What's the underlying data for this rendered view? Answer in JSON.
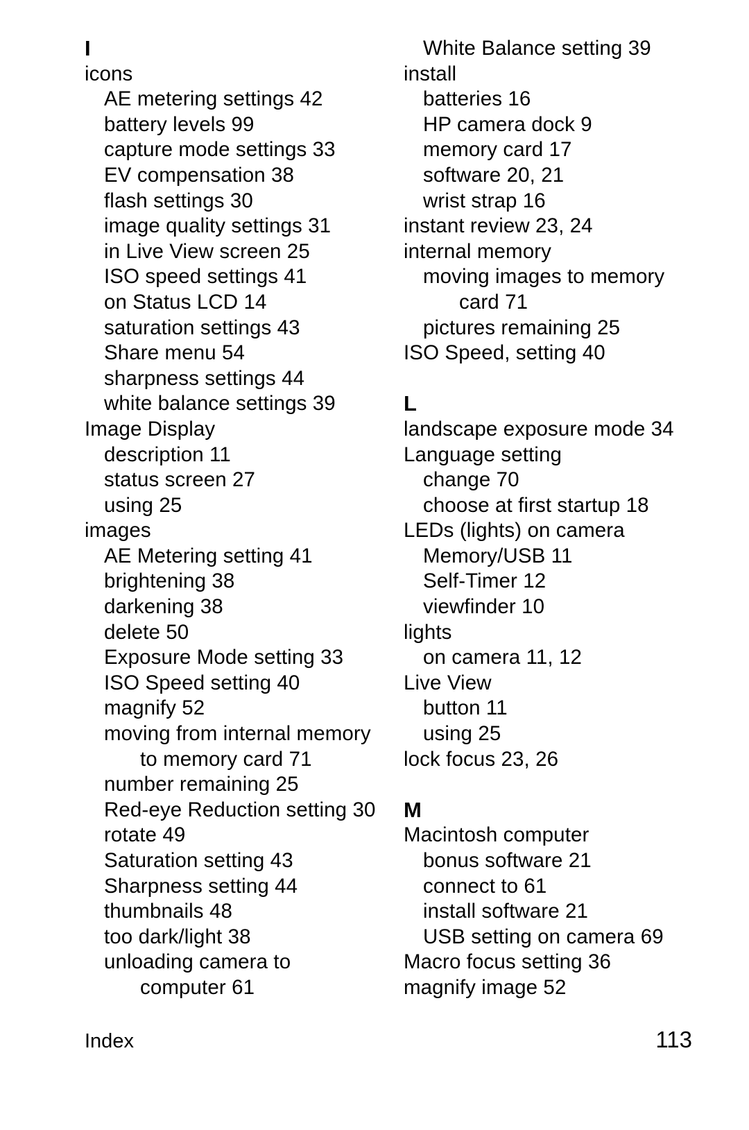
{
  "document": {
    "type": "index",
    "footer": {
      "label": "Index",
      "page_number": "113"
    }
  },
  "columns": {
    "left": {
      "blocks": [
        {
          "kind": "letter",
          "text": "I",
          "spaced_before": false
        },
        {
          "kind": "entry",
          "level": 0,
          "text": "icons"
        },
        {
          "kind": "entry",
          "level": 1,
          "text": "AE metering settings 42"
        },
        {
          "kind": "entry",
          "level": 1,
          "text": "battery levels 99"
        },
        {
          "kind": "entry",
          "level": 1,
          "text": "capture mode settings 33"
        },
        {
          "kind": "entry",
          "level": 1,
          "text": "EV compensation 38"
        },
        {
          "kind": "entry",
          "level": 1,
          "text": "flash settings 30"
        },
        {
          "kind": "entry",
          "level": 1,
          "text": "image quality settings 31"
        },
        {
          "kind": "entry",
          "level": 1,
          "text": "in Live View screen 25"
        },
        {
          "kind": "entry",
          "level": 1,
          "text": "ISO speed settings 41"
        },
        {
          "kind": "entry",
          "level": 1,
          "text": "on Status LCD 14"
        },
        {
          "kind": "entry",
          "level": 1,
          "text": "saturation settings 43"
        },
        {
          "kind": "entry",
          "level": 1,
          "text": "Share menu 54"
        },
        {
          "kind": "entry",
          "level": 1,
          "text": "sharpness settings 44"
        },
        {
          "kind": "entry",
          "level": 1,
          "text": "white balance settings 39"
        },
        {
          "kind": "entry",
          "level": 0,
          "text": "Image Display"
        },
        {
          "kind": "entry",
          "level": 1,
          "text": "description 11"
        },
        {
          "kind": "entry",
          "level": 1,
          "text": "status screen 27"
        },
        {
          "kind": "entry",
          "level": 1,
          "text": "using 25"
        },
        {
          "kind": "entry",
          "level": 0,
          "text": "images"
        },
        {
          "kind": "entry",
          "level": 1,
          "text": "AE Metering setting 41"
        },
        {
          "kind": "entry",
          "level": 1,
          "text": "brightening 38"
        },
        {
          "kind": "entry",
          "level": 1,
          "text": "darkening 38"
        },
        {
          "kind": "entry",
          "level": 1,
          "text": "delete 50"
        },
        {
          "kind": "entry",
          "level": 1,
          "text": "Exposure Mode setting 33"
        },
        {
          "kind": "entry",
          "level": 1,
          "text": "ISO Speed setting 40"
        },
        {
          "kind": "entry",
          "level": 1,
          "text": "magnify 52"
        },
        {
          "kind": "entry",
          "level": 1,
          "text": "moving from internal memory"
        },
        {
          "kind": "entry",
          "level": 2,
          "text": "to memory card 71"
        },
        {
          "kind": "entry",
          "level": 1,
          "text": "number remaining 25"
        },
        {
          "kind": "entry",
          "level": 1,
          "text": "Red-eye Reduction setting 30"
        },
        {
          "kind": "entry",
          "level": 1,
          "text": "rotate 49"
        },
        {
          "kind": "entry",
          "level": 1,
          "text": "Saturation setting 43"
        },
        {
          "kind": "entry",
          "level": 1,
          "text": "Sharpness setting 44"
        },
        {
          "kind": "entry",
          "level": 1,
          "text": "thumbnails 48"
        },
        {
          "kind": "entry",
          "level": 1,
          "text": "too dark/light 38"
        },
        {
          "kind": "entry",
          "level": 1,
          "text": "unloading camera to"
        },
        {
          "kind": "entry",
          "level": 2,
          "text": "computer 61"
        }
      ]
    },
    "right": {
      "blocks": [
        {
          "kind": "entry",
          "level": 1,
          "text": "White Balance setting 39"
        },
        {
          "kind": "entry",
          "level": 0,
          "text": "install"
        },
        {
          "kind": "entry",
          "level": 1,
          "text": "batteries 16"
        },
        {
          "kind": "entry",
          "level": 1,
          "text": "HP camera dock 9"
        },
        {
          "kind": "entry",
          "level": 1,
          "text": "memory card 17"
        },
        {
          "kind": "entry",
          "level": 1,
          "text": "software 20, 21"
        },
        {
          "kind": "entry",
          "level": 1,
          "text": "wrist strap 16"
        },
        {
          "kind": "entry",
          "level": 0,
          "text": "instant review 23, 24"
        },
        {
          "kind": "entry",
          "level": 0,
          "text": "internal memory"
        },
        {
          "kind": "entry",
          "level": 1,
          "text": "moving images to memory"
        },
        {
          "kind": "entry",
          "level": 2,
          "text": "card 71"
        },
        {
          "kind": "entry",
          "level": 1,
          "text": "pictures remaining 25"
        },
        {
          "kind": "entry",
          "level": 0,
          "text": "ISO Speed, setting 40"
        },
        {
          "kind": "gap"
        },
        {
          "kind": "letter",
          "text": "L",
          "spaced_before": false
        },
        {
          "kind": "entry",
          "level": 0,
          "text": "landscape exposure mode 34"
        },
        {
          "kind": "entry",
          "level": 0,
          "text": "Language setting"
        },
        {
          "kind": "entry",
          "level": 1,
          "text": "change 70"
        },
        {
          "kind": "entry",
          "level": 1,
          "text": "choose at first startup 18"
        },
        {
          "kind": "entry",
          "level": 0,
          "text": "LEDs (lights) on camera"
        },
        {
          "kind": "entry",
          "level": 1,
          "text": "Memory/USB 11"
        },
        {
          "kind": "entry",
          "level": 1,
          "text": "Self-Timer 12"
        },
        {
          "kind": "entry",
          "level": 1,
          "text": "viewfinder 10"
        },
        {
          "kind": "entry",
          "level": 0,
          "text": "lights"
        },
        {
          "kind": "entry",
          "level": 1,
          "text": "on camera 11, 12"
        },
        {
          "kind": "entry",
          "level": 0,
          "text": "Live View"
        },
        {
          "kind": "entry",
          "level": 1,
          "text": "button 11"
        },
        {
          "kind": "entry",
          "level": 1,
          "text": "using 25"
        },
        {
          "kind": "entry",
          "level": 0,
          "text": "lock focus 23, 26"
        },
        {
          "kind": "gap"
        },
        {
          "kind": "letter",
          "text": "M",
          "spaced_before": false
        },
        {
          "kind": "entry",
          "level": 0,
          "text": "Macintosh computer"
        },
        {
          "kind": "entry",
          "level": 1,
          "text": "bonus software 21"
        },
        {
          "kind": "entry",
          "level": 1,
          "text": "connect to 61"
        },
        {
          "kind": "entry",
          "level": 1,
          "text": "install software 21"
        },
        {
          "kind": "entry",
          "level": 1,
          "text": "USB setting on camera 69"
        },
        {
          "kind": "entry",
          "level": 0,
          "text": "Macro focus setting 36"
        },
        {
          "kind": "entry",
          "level": 0,
          "text": "magnify image 52"
        }
      ]
    }
  }
}
